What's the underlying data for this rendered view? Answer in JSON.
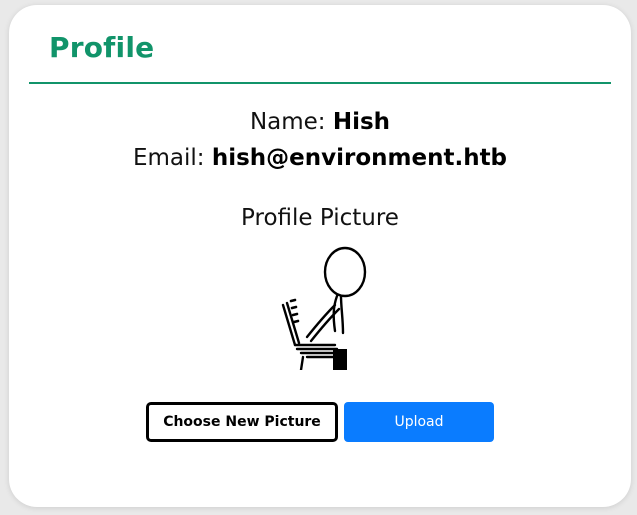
{
  "profile": {
    "title": "Profile",
    "name_label": "Name:",
    "name_value": "Hish",
    "email_label": "Email:",
    "email_value": "hish@environment.htb",
    "picture_heading": "Profile Picture"
  },
  "actions": {
    "choose_label": "Choose New Picture",
    "upload_label": "Upload"
  },
  "colors": {
    "accent": "#11946a",
    "upload_button": "#0a7cff",
    "background": "#e9e9e9"
  }
}
